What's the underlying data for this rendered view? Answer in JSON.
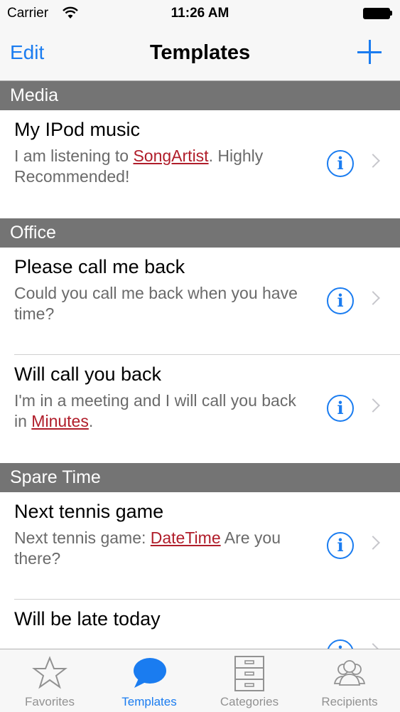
{
  "status_bar": {
    "carrier": "Carrier",
    "time": "11:26 AM"
  },
  "nav": {
    "edit_label": "Edit",
    "title": "Templates"
  },
  "sections": [
    {
      "header": "Media",
      "rows": [
        {
          "title": "My IPod music",
          "detail_pre": "I am listening to ",
          "token": "SongArtist",
          "detail_post": ". Highly Recommended!"
        }
      ]
    },
    {
      "header": "Office",
      "rows": [
        {
          "title": "Please call  me back",
          "detail_pre": "Could you call me back when you have time?",
          "token": "",
          "detail_post": ""
        },
        {
          "title": "Will call you back",
          "detail_pre": "I'm in a meeting and I will call you back in ",
          "token": "Minutes",
          "detail_post": "."
        }
      ]
    },
    {
      "header": "Spare Time",
      "rows": [
        {
          "title": "Next tennis game",
          "detail_pre": "Next tennis game: ",
          "token": "DateTime",
          "detail_post": " Are you there?"
        },
        {
          "title": "Will be late today",
          "detail_pre": "",
          "token": "",
          "detail_post": ""
        }
      ]
    }
  ],
  "tabs": [
    {
      "label": "Favorites",
      "icon": "star-icon",
      "active": false
    },
    {
      "label": "Templates",
      "icon": "speech-bubble-icon",
      "active": true
    },
    {
      "label": "Categories",
      "icon": "cabinet-icon",
      "active": false
    },
    {
      "label": "Recipients",
      "icon": "people-icon",
      "active": false
    }
  ],
  "colors": {
    "accent": "#1a7cf0",
    "token": "#b01d2a",
    "section_header": "#747474"
  }
}
